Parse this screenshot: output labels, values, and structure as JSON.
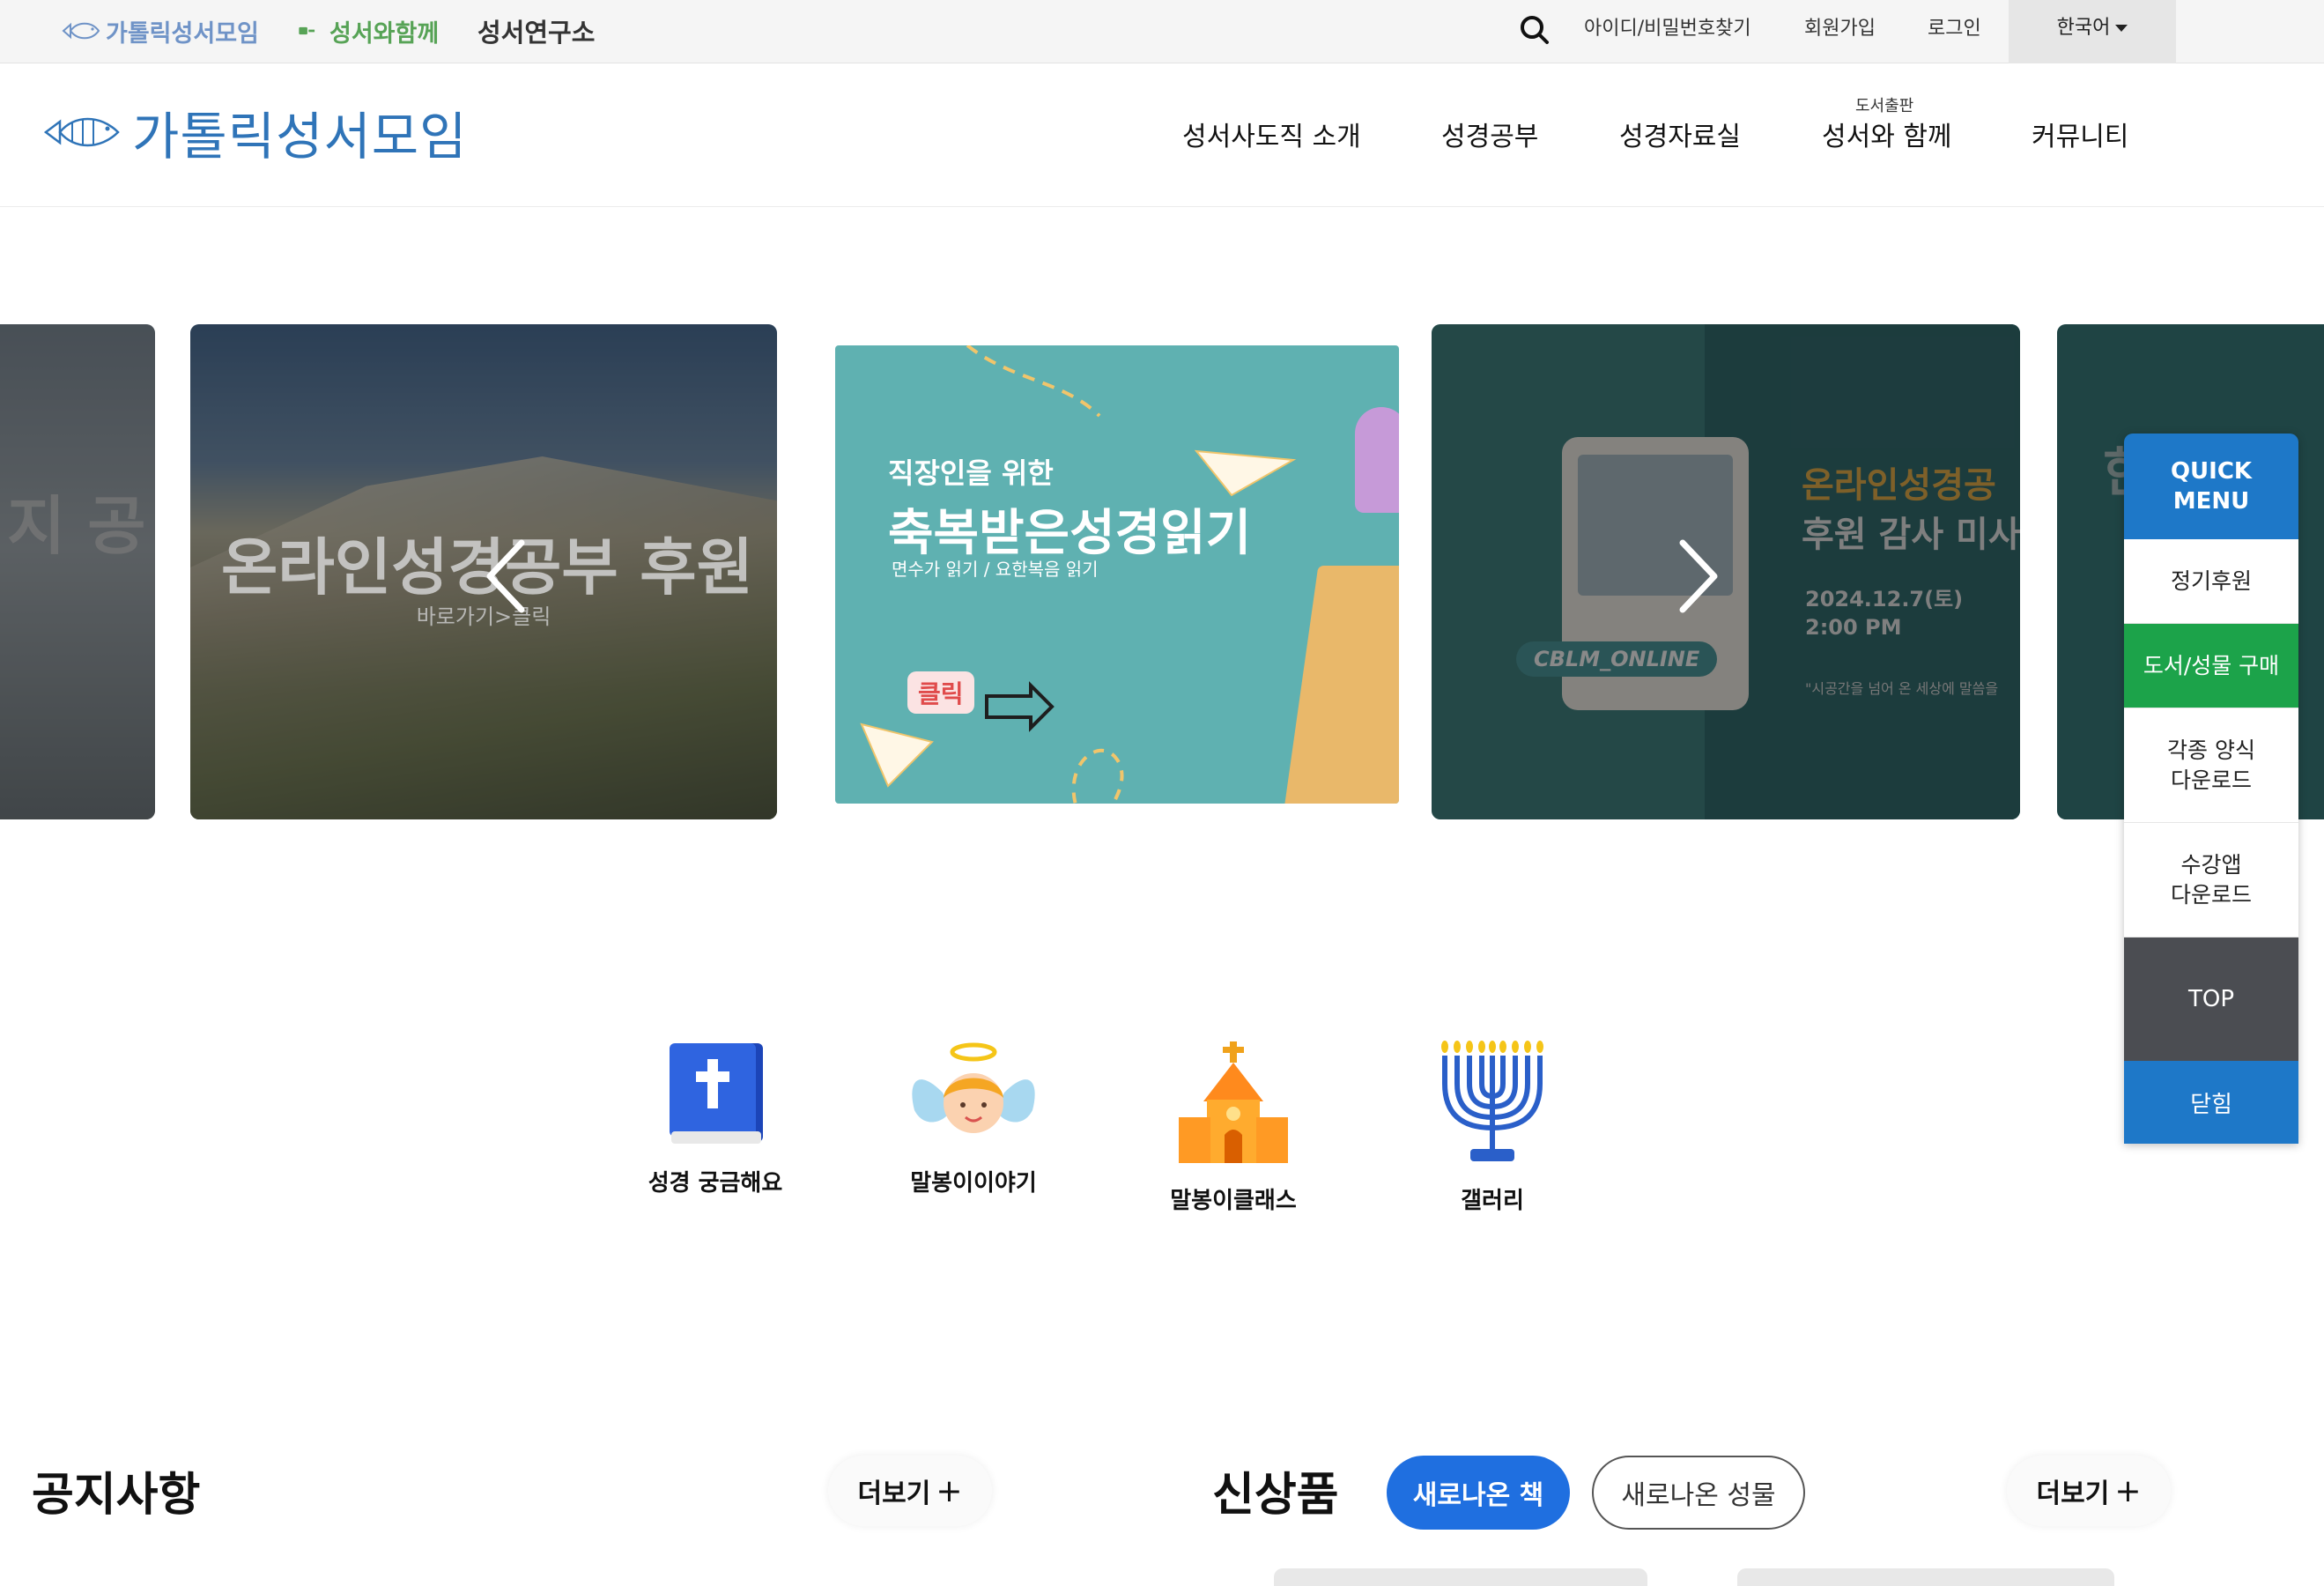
{
  "topbar": {
    "sites": [
      "가톨릭성서모임",
      "성서와함께",
      "성서연구소"
    ],
    "links": {
      "find": "아이디/비밀번호찾기",
      "join": "회원가입",
      "login": "로그인"
    },
    "language": "한국어"
  },
  "header": {
    "logo_text": "가톨릭성서모임",
    "nav": [
      "성서사도직 소개",
      "성경공부",
      "성경자료실",
      "성서와 함께",
      "커뮤니티"
    ],
    "nav_sup": "도서출판"
  },
  "carousel": {
    "slide_a_text": "지 공",
    "slide_b": {
      "title": "온라인성경공부 후원",
      "sub": "바로가기>클릭"
    },
    "slide_c": {
      "line1": "직장인을 위한",
      "line2": "축복받은성경읽기",
      "line3": "면수가 읽기 / 요한복음 읽기",
      "tag": "클릭"
    },
    "slide_d": {
      "title1": "온라인성경공",
      "title2": "후원 감사 미사",
      "date": "2024.12.7(토)",
      "time": "2:00 PM",
      "note": "\"시공간을 넘어 온 세상에 말씀을",
      "badge": "CBLM_ONLINE"
    },
    "slide_e_text": "한"
  },
  "quick_menu": {
    "header": "QUICK\nMENU",
    "items": [
      "정기후원",
      "도서/성물 구매",
      "각종 양식\n다운로드",
      "수강앱\n다운로드"
    ],
    "top": "TOP",
    "close": "닫힘"
  },
  "categories": [
    "성경 궁금해요",
    "말봉이이야기",
    "말봉이클래스",
    "갤러리"
  ],
  "notice": {
    "title": "공지사항",
    "more": "더보기"
  },
  "products": {
    "title": "신상품",
    "tab_books": "새로나온 책",
    "tab_goods": "새로나온 성물",
    "more": "더보기"
  },
  "colors": {
    "brand_blue": "#2f74b8",
    "quick_blue": "#1e78c8",
    "quick_green": "#1ca34a",
    "pill_blue": "#1f6fe0"
  }
}
